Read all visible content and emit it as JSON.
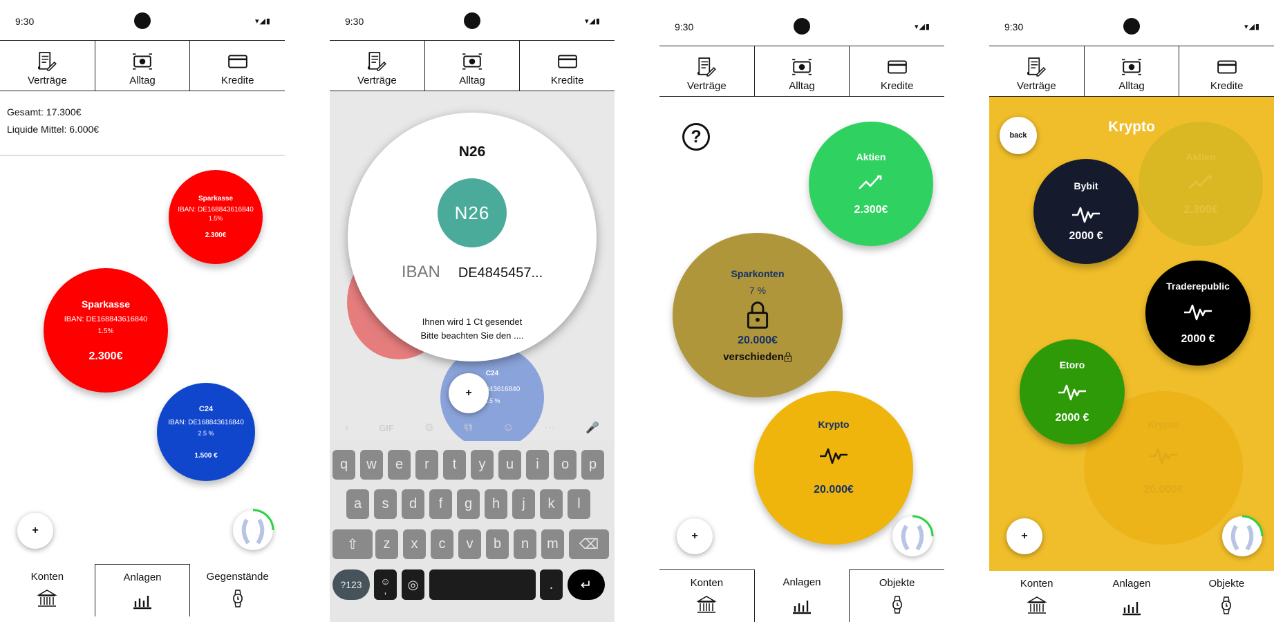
{
  "status": {
    "time": "9:30"
  },
  "topnav": [
    "Verträge",
    "Alltag",
    "Kredite"
  ],
  "screen1": {
    "total": "Gesamt: 17.300€",
    "liquid": "Liquide Mittel: 6.000€",
    "bubbles": [
      {
        "name": "Sparkasse",
        "iban": "IBAN: DE168843616840",
        "rate": "1.5%",
        "amount": "2.300€"
      },
      {
        "name": "Sparkasse",
        "iban": "IBAN: DE168843616840",
        "rate": "1.5%",
        "amount": "2.300€"
      },
      {
        "name": "C24",
        "iban": "IBAN: DE168843616840",
        "rate": "2.5 %",
        "amount": "1.500 €"
      }
    ],
    "fab": "+",
    "bottomnav": [
      "Konten",
      "Anlagen",
      "Gegenstände"
    ]
  },
  "screen2": {
    "bank_title": "N26",
    "logo_text": "N26",
    "iban_label": "IBAN",
    "iban_value": "DE4845457...",
    "msg1": "Ihnen wird 1 Ct gesendet",
    "msg2": "Bitte beachten Sie den ....",
    "c24_name": "C24",
    "c24_iban": "DE168843616840",
    "c24_rate": "2.5 %",
    "fab": "+",
    "keyboard": {
      "toolbar": [
        "‹",
        "GIF",
        "⚙",
        "⧉",
        "☺",
        "···",
        "🎤"
      ],
      "row1": [
        "q",
        "w",
        "e",
        "r",
        "t",
        "y",
        "u",
        "i",
        "o",
        "p"
      ],
      "row2": [
        "a",
        "s",
        "d",
        "f",
        "g",
        "h",
        "j",
        "k",
        "l"
      ],
      "row3": [
        "z",
        "x",
        "c",
        "v",
        "b",
        "n",
        "m"
      ],
      "sym": "?123",
      "emoji": "☺",
      "comma": ",",
      "period": "."
    }
  },
  "screen3": {
    "help": "?",
    "aktien_label": "Aktien",
    "aktien_amount": "2.300€",
    "spar_label": "Sparkonten",
    "spar_rate": "7 %",
    "spar_amount": "20.000€",
    "spar_note": "verschieden",
    "krypto_label": "Krypto",
    "krypto_amount": "20.000€",
    "fab": "+",
    "bottomnav": [
      "Konten",
      "Anlagen",
      "Objekte"
    ]
  },
  "screen4": {
    "back": "back",
    "title": "Krypto",
    "bybit": "Bybit",
    "bybit_amount": "2000 €",
    "trade": "Traderepublic",
    "trade_amount": "2000 €",
    "etoro": "Etoro",
    "etoro_amount": "2000 €",
    "ghost_aktien": "Aktien",
    "ghost_aktien_amount": "2.300€",
    "ghost_krypto": "Krypto",
    "ghost_krypto_amount": "20.000€",
    "fab": "+",
    "bottomnav": [
      "Konten",
      "Anlagen",
      "Objekte"
    ]
  },
  "colors": {
    "red": "#ff0000",
    "blue": "#0f46cc",
    "n26": "#4aab9a",
    "green": "#2fd160",
    "gold": "#b0963a",
    "yellow": "#efb50d",
    "krypto_bg": "#f0be2a",
    "navy": "#151a2d",
    "etoro": "#2e9a08"
  }
}
